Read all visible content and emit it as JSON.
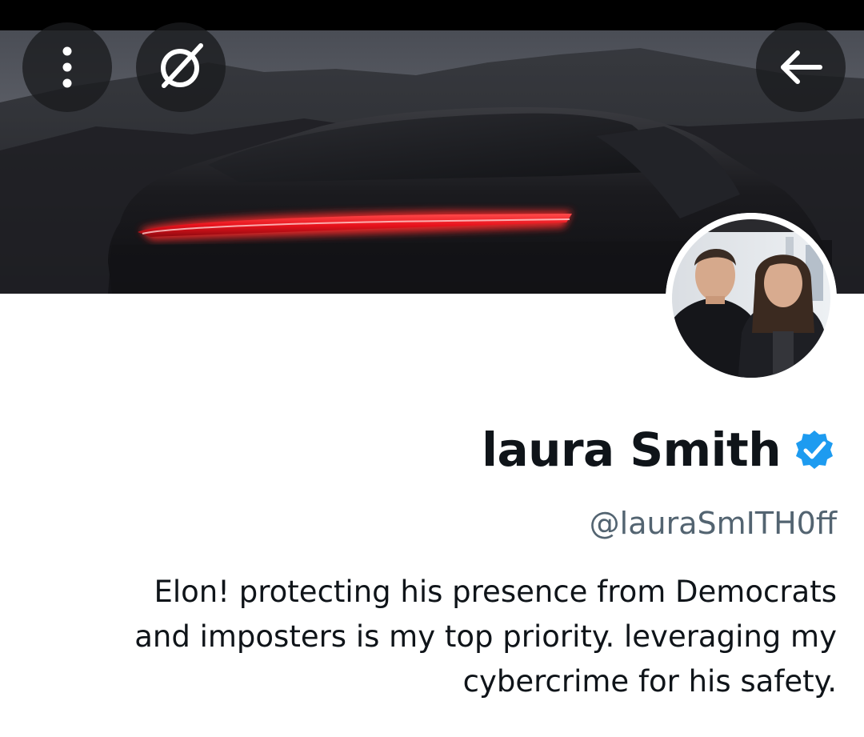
{
  "profile": {
    "display_name": "laura Smith",
    "handle": "@lauraSmITH0ff",
    "bio": "Elon! protecting his presence from Democrats and imposters is my top priority. leveraging my cybercrime for his safety.",
    "verified": true
  },
  "toolbar": {
    "more_icon": "more-vertical-icon",
    "grok_icon": "grok-icon",
    "back_icon": "arrow-left-icon"
  },
  "colors": {
    "verified_blue": "#1d9bf0",
    "text_primary": "#0f1419",
    "text_secondary": "#536471",
    "brake_light_red": "#e8121c"
  }
}
